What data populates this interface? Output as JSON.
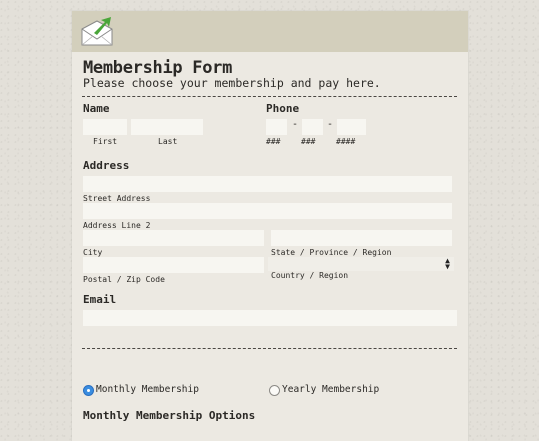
{
  "form": {
    "title": "Membership Form",
    "subtitle": "Please choose your membership and pay here."
  },
  "name": {
    "label": "Name",
    "first_label": "First",
    "last_label": "Last",
    "first_value": "",
    "last_value": ""
  },
  "phone": {
    "label": "Phone",
    "separator": "-",
    "area_hint": "###",
    "prefix_hint": "###",
    "line_hint": "####"
  },
  "address": {
    "label": "Address",
    "street_label": "Street Address",
    "line2_label": "Address Line 2",
    "city_label": "City",
    "state_label": "State / Province / Region",
    "zip_label": "Postal / Zip Code",
    "country_label": "Country / Region",
    "country_value": ""
  },
  "email": {
    "label": "Email",
    "value": ""
  },
  "membership": {
    "options": [
      {
        "label": "Monthly Membership",
        "selected": true
      },
      {
        "label": "Yearly Membership",
        "selected": false
      }
    ],
    "options_heading": "Monthly Membership Options"
  },
  "colors": {
    "background": "#e3e0d9",
    "card": "#ece9e2",
    "header_bar": "#d3cfbc",
    "radio_selected": "#3a8de0",
    "logo_arrow": "#4aa63a"
  }
}
